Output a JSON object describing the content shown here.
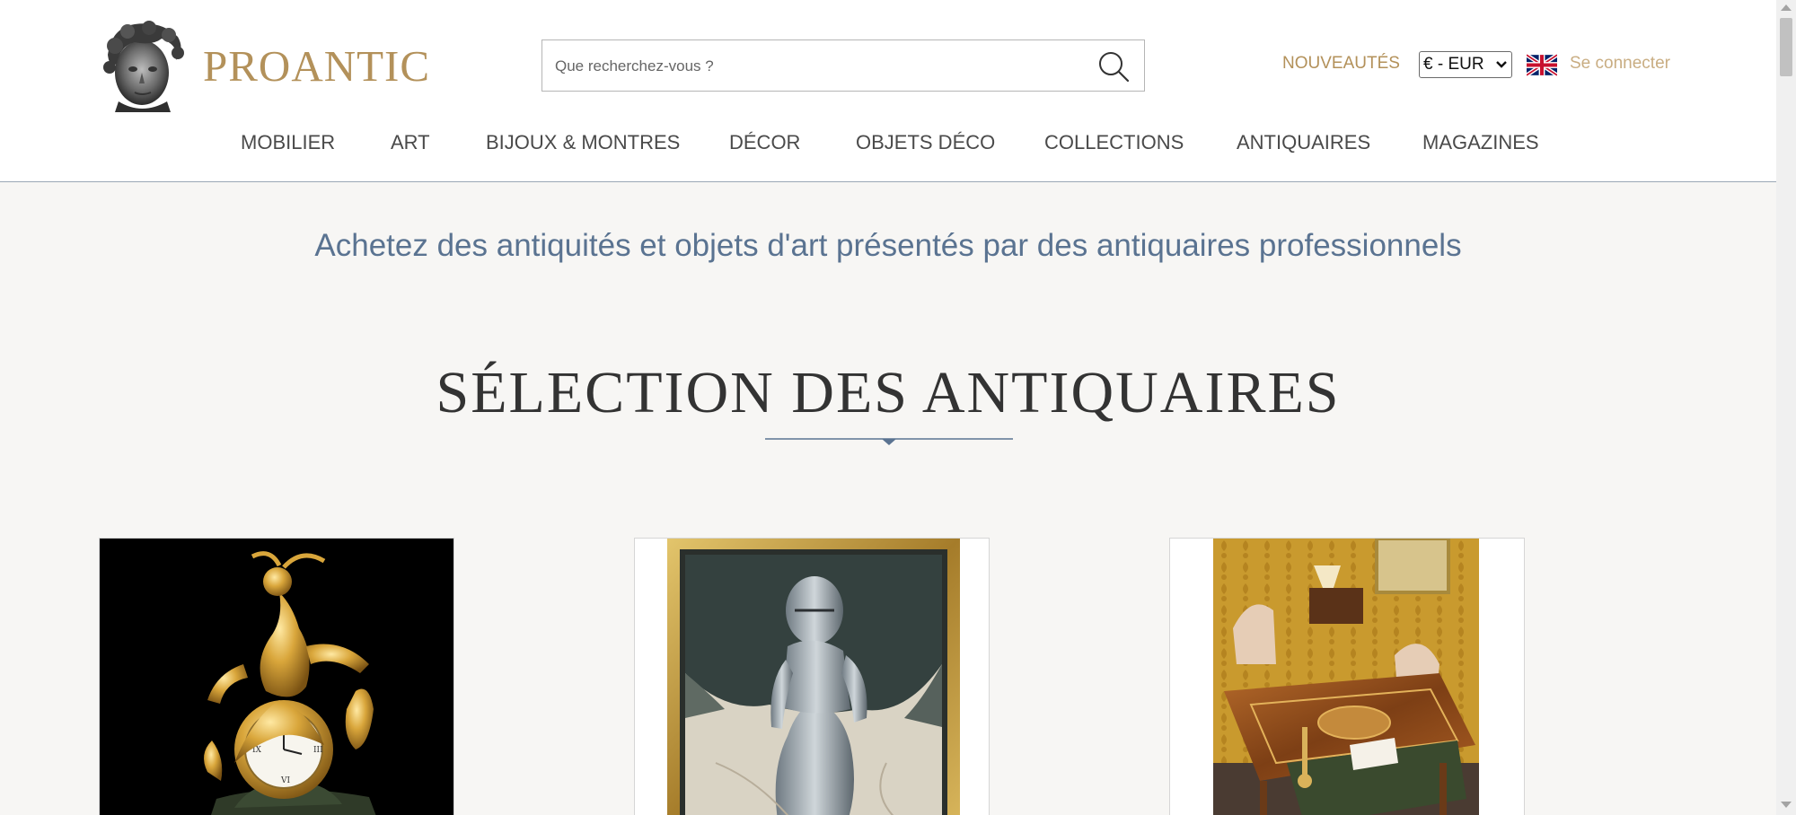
{
  "brand": {
    "name": "PROANTIC",
    "color": "#b3915a"
  },
  "search": {
    "placeholder": "Que recherchez-vous ?"
  },
  "header_links": {
    "nouveautes": "NOUVEAUTÉS",
    "currency": "€ - EUR",
    "login": "Se connecter"
  },
  "nav": [
    "MOBILIER",
    "ART",
    "BIJOUX & MONTRES",
    "DÉCOR",
    "OBJETS DÉCO",
    "COLLECTIONS",
    "ANTIQUAIRES",
    "MAGAZINES"
  ],
  "tagline": "Achetez des antiquités et objets d'art présentés par des antiquaires professionnels",
  "section_title": "SÉLECTION DES ANTIQUAIRES",
  "cards": [
    {
      "image": "gilt-bronze-mantel-clock"
    },
    {
      "image": "framed-knight-armor-painting"
    },
    {
      "image": "marquetry-desk-in-showroom"
    }
  ],
  "icons": {
    "search": "search-icon",
    "flag": "uk-flag-icon",
    "chevron": "chevron-down-icon"
  },
  "colors": {
    "accent": "#b3915a",
    "tagline": "#5a7391",
    "nav_text": "#4a4a4a",
    "background": "#f7f6f4"
  }
}
